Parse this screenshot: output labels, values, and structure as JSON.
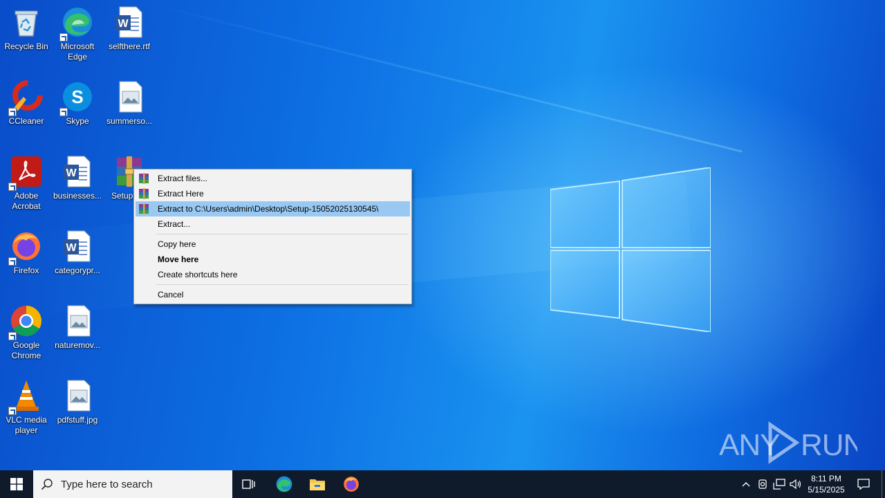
{
  "desktop": {
    "icons": [
      {
        "label": "Recycle Bin",
        "icon": "recycle-bin-icon"
      },
      {
        "label": "Microsoft\nEdge",
        "icon": "edge-icon"
      },
      {
        "label": "selfthere.rtf",
        "icon": "word-document-icon"
      },
      {
        "label": "CCleaner",
        "icon": "ccleaner-icon"
      },
      {
        "label": "Skype",
        "icon": "skype-icon"
      },
      {
        "label": "summerso...",
        "icon": "image-file-icon"
      },
      {
        "label": "Adobe\nAcrobat",
        "icon": "acrobat-icon"
      },
      {
        "label": "businesses...",
        "icon": "word-document-icon"
      },
      {
        "label": "Setup-1...",
        "icon": "winrar-archive-icon"
      },
      {
        "label": "Firefox",
        "icon": "firefox-icon"
      },
      {
        "label": "categorypr...",
        "icon": "word-document-icon"
      },
      {
        "label": "Google\nChrome",
        "icon": "chrome-icon"
      },
      {
        "label": "naturemov...",
        "icon": "image-file-icon"
      },
      {
        "label": "VLC media\nplayer",
        "icon": "vlc-icon"
      },
      {
        "label": "pdfstuff.jpg",
        "icon": "image-file-icon"
      }
    ]
  },
  "context_menu": {
    "items": [
      {
        "label": "Extract files...",
        "icon": "winrar-icon"
      },
      {
        "label": "Extract Here",
        "icon": "winrar-icon"
      },
      {
        "label": "Extract to C:\\Users\\admin\\Desktop\\Setup-15052025130545\\",
        "icon": "winrar-icon",
        "highlighted": true
      },
      {
        "label": "Extract..."
      },
      {
        "label": "Copy here"
      },
      {
        "label": "Move here",
        "bold": true
      },
      {
        "label": "Create shortcuts here"
      },
      {
        "label": "Cancel"
      }
    ]
  },
  "watermark": {
    "text": "ANY RUN"
  },
  "taskbar": {
    "search_placeholder": "Type here to search",
    "pinned": [
      "task-view-icon",
      "edge-icon",
      "file-explorer-icon",
      "firefox-icon"
    ],
    "clock": {
      "time": "8:11 PM",
      "date": "5/15/2025"
    }
  },
  "colors": {
    "menu_highlight": "#99c9f2",
    "taskbar": "#0f1a2b",
    "desktop_blue": "#0d6fe3"
  }
}
